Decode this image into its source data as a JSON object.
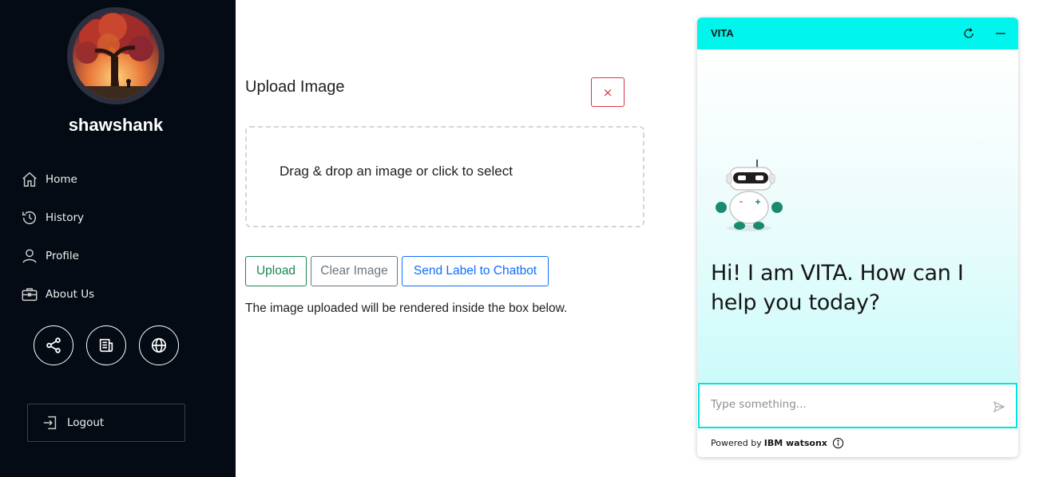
{
  "sidebar": {
    "username": "shawshank",
    "nav": [
      {
        "label": "Home",
        "icon": "home-icon"
      },
      {
        "label": "History",
        "icon": "history-icon"
      },
      {
        "label": "Profile",
        "icon": "person-icon"
      },
      {
        "label": "About Us",
        "icon": "briefcase-icon"
      }
    ],
    "social": [
      "share-icon",
      "newspaper-icon",
      "globe-icon"
    ],
    "logout_label": "Logout"
  },
  "main": {
    "title": "Upload Image",
    "close_label": "×",
    "dropzone_text": "Drag & drop an image or click to select",
    "buttons": {
      "upload": "Upload",
      "clear": "Clear Image",
      "send": "Send Label to Chatbot"
    },
    "note": "The image uploaded will be rendered inside the box below."
  },
  "chat": {
    "title": "VITA",
    "greeting": "Hi! I am VITA. How can I help you today?",
    "input_placeholder": "Type something...",
    "footer_prefix": "Powered by",
    "footer_brand": "IBM watsonx"
  },
  "colors": {
    "sidebar_bg": "#040b14",
    "chat_header": "#00f5ec",
    "upload_green": "#198754",
    "clear_gray": "#6c757d",
    "send_blue": "#0d6efd",
    "close_red": "#dc3545"
  }
}
